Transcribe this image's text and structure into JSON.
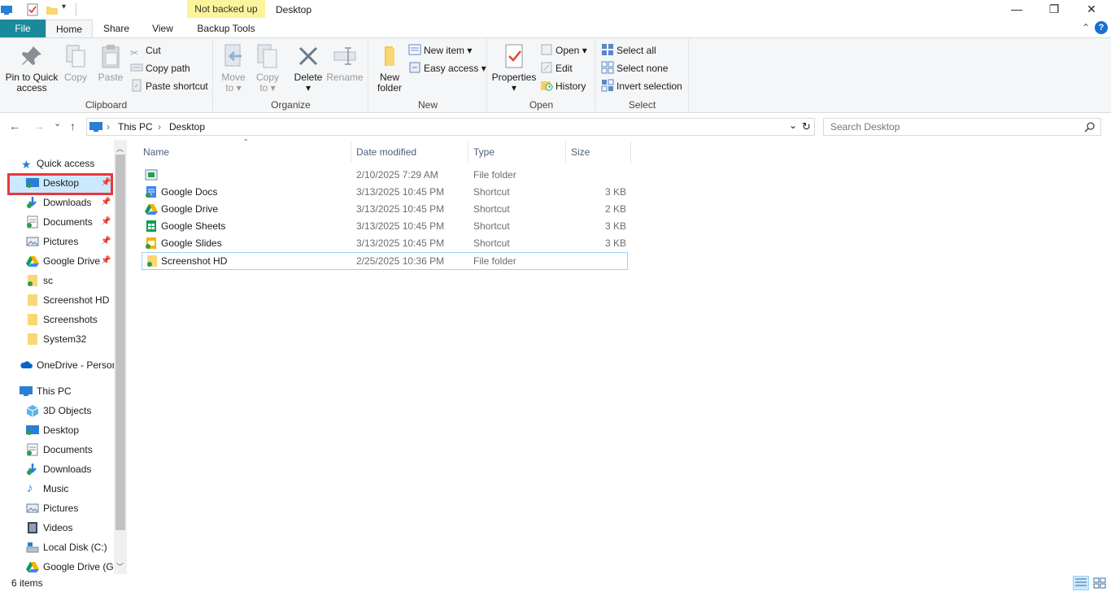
{
  "titlebar": {
    "title": "Desktop",
    "context_tab_label": "Not backed up",
    "minimize": "—",
    "maximize": "❐",
    "close": "✕"
  },
  "tabs": {
    "file": "File",
    "home": "Home",
    "share": "Share",
    "view": "View",
    "backup_tools": "Backup Tools",
    "collapse": "⌃",
    "help": "?"
  },
  "ribbon": {
    "clipboard": {
      "label": "Clipboard",
      "pin": "Pin to Quick access",
      "pin_l1": "Pin to Quick",
      "pin_l2": "access",
      "copy": "Copy",
      "paste": "Paste",
      "cut": "Cut",
      "copy_path": "Copy path",
      "paste_shortcut": "Paste shortcut"
    },
    "organize": {
      "label": "Organize",
      "move_l1": "Move",
      "move_l2": "to ▾",
      "copy_l1": "Copy",
      "copy_l2": "to ▾",
      "delete_l1": "Delete",
      "delete_l2": "▾",
      "rename": "Rename"
    },
    "new": {
      "label": "New",
      "folder_l1": "New",
      "folder_l2": "folder",
      "new_item": "New item ▾",
      "easy_access": "Easy access ▾"
    },
    "open": {
      "label": "Open",
      "properties": "Properties",
      "properties_l2": "▾",
      "open": "Open ▾",
      "edit": "Edit",
      "history": "History"
    },
    "select": {
      "label": "Select",
      "select_all": "Select all",
      "select_none": "Select none",
      "invert": "Invert selection"
    }
  },
  "nav": {
    "back": "←",
    "forward": "→",
    "recent": "⌄",
    "up": "↑",
    "breadcrumb": [
      "This PC",
      "Desktop"
    ],
    "sep": "›",
    "dropdown": "⌄",
    "refresh": "↻",
    "search_placeholder": "Search Desktop"
  },
  "sidebar": {
    "quick_access": "Quick access",
    "quick_items": [
      {
        "label": "Desktop",
        "pinned": true
      },
      {
        "label": "Downloads",
        "pinned": true
      },
      {
        "label": "Documents",
        "pinned": true
      },
      {
        "label": "Pictures",
        "pinned": true
      },
      {
        "label": "Google Drive",
        "pinned": true
      },
      {
        "label": "sc",
        "pinned": false
      },
      {
        "label": "Screenshot HD",
        "pinned": false
      },
      {
        "label": "Screenshots",
        "pinned": false
      },
      {
        "label": "System32",
        "pinned": false
      }
    ],
    "onedrive": "OneDrive - Persor",
    "this_pc": "This PC",
    "pc_items": [
      "3D Objects",
      "Desktop",
      "Documents",
      "Downloads",
      "Music",
      "Pictures",
      "Videos",
      "Local Disk (C:)",
      "Google Drive (G:"
    ],
    "pin_glyph": "📌"
  },
  "files": {
    "columns": {
      "name": "Name",
      "date": "Date modified",
      "type": "Type",
      "size": "Size",
      "sort_arrow": "⌃"
    },
    "rows": [
      {
        "name": "",
        "date": "2/10/2025 7:29 AM",
        "type": "File folder",
        "size": "",
        "icon": "special-folder-icon"
      },
      {
        "name": "Google Docs",
        "date": "3/13/2025 10:45 PM",
        "type": "Shortcut",
        "size": "3 KB",
        "icon": "google-docs-icon"
      },
      {
        "name": "Google Drive",
        "date": "3/13/2025 10:45 PM",
        "type": "Shortcut",
        "size": "2 KB",
        "icon": "google-drive-icon"
      },
      {
        "name": "Google Sheets",
        "date": "3/13/2025 10:45 PM",
        "type": "Shortcut",
        "size": "3 KB",
        "icon": "google-sheets-icon"
      },
      {
        "name": "Google Slides",
        "date": "3/13/2025 10:45 PM",
        "type": "Shortcut",
        "size": "3 KB",
        "icon": "google-slides-icon"
      },
      {
        "name": "Screenshot HD",
        "date": "2/25/2025 10:36 PM",
        "type": "File folder",
        "size": "",
        "icon": "folder-icon"
      }
    ]
  },
  "status": {
    "count": "6 items"
  },
  "colors": {
    "file_tab": "#1a8a9a",
    "context_tab": "#fbf49a",
    "selection": "#cce8ff",
    "highlight_box": "#e8383d"
  }
}
